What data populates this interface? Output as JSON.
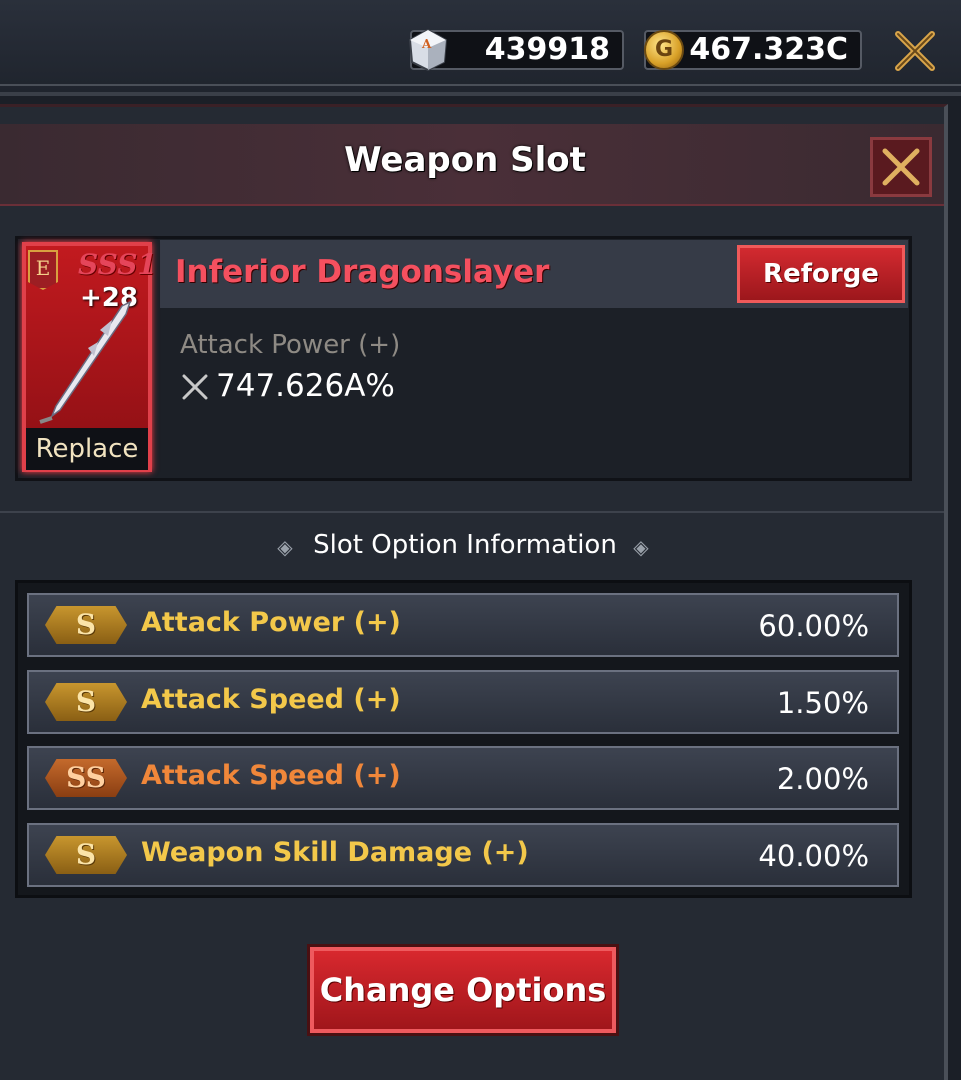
{
  "currencies": {
    "gem": {
      "value": "439918",
      "icon": "gem-dice-icon"
    },
    "gold": {
      "value": "467.323C",
      "icon": "gold-coin-icon",
      "symbol": "G"
    }
  },
  "panel": {
    "title": "Weapon Slot"
  },
  "weapon": {
    "name": "Inferior Dragonslayer",
    "grade_letter": "E",
    "rank": "SSS1",
    "enhance": "+28",
    "replace_label": "Replace",
    "reforge_label": "Reforge",
    "stat_label": "Attack Power (+)",
    "stat_value": "747.626A%"
  },
  "slot_options": {
    "title": "Slot Option Information",
    "rows": [
      {
        "grade": "S",
        "name": "Attack Power (+)",
        "value": "60.00%",
        "color": "#f3c84a"
      },
      {
        "grade": "S",
        "name": "Attack Speed (+)",
        "value": "1.50%",
        "color": "#f3c84a"
      },
      {
        "grade": "SS",
        "name": "Attack Speed (+)",
        "value": "2.00%",
        "color": "#f0873a"
      },
      {
        "grade": "S",
        "name": "Weapon Skill Damage (+)",
        "value": "40.00%",
        "color": "#f3c84a"
      }
    ]
  },
  "actions": {
    "change_options_label": "Change Options"
  }
}
